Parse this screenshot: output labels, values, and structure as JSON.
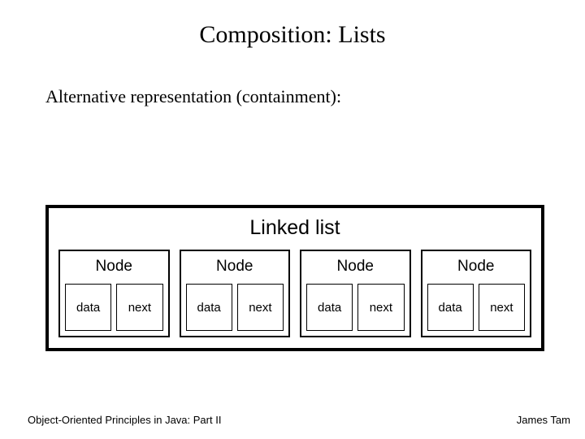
{
  "title": "Composition: Lists",
  "subtitle": "Alternative representation (containment):",
  "linked_list": {
    "label": "Linked list",
    "nodes": [
      {
        "label": "Node",
        "data": "data",
        "next": "next"
      },
      {
        "label": "Node",
        "data": "data",
        "next": "next"
      },
      {
        "label": "Node",
        "data": "data",
        "next": "next"
      },
      {
        "label": "Node",
        "data": "data",
        "next": "next"
      }
    ]
  },
  "footer": {
    "left": "Object-Oriented Principles in Java: Part II",
    "right": "James Tam"
  }
}
